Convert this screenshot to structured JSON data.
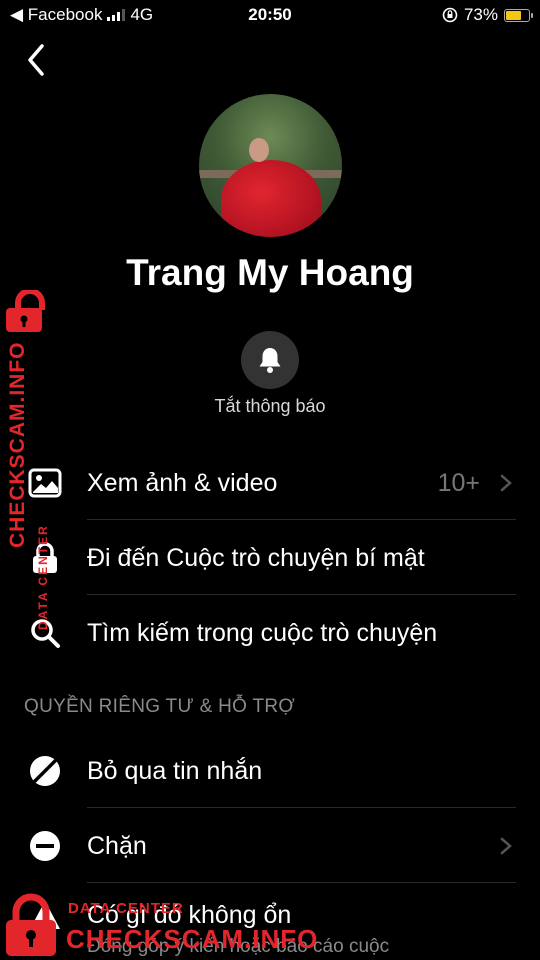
{
  "status_bar": {
    "back_app": "◀ Facebook",
    "network": "4G",
    "time": "20:50",
    "battery": "73%",
    "battery_level": 0.73,
    "battery_color": "#f5c518"
  },
  "header": {
    "back_icon": "chevron-left-icon"
  },
  "profile": {
    "name": "Trang My Hoang",
    "mute_label": "Tắt thông báo",
    "mute_icon": "bell-icon"
  },
  "menu": {
    "items": [
      {
        "label": "Xem ảnh & video",
        "count": "10+",
        "icon": "image-icon"
      },
      {
        "label": "Đi đến Cuộc trò chuyện bí mật",
        "icon": "lock-icon"
      },
      {
        "label": "Tìm kiếm trong cuộc trò chuyện",
        "icon": "search-icon"
      }
    ]
  },
  "privacy": {
    "section_title": "QUYỀN RIÊNG TƯ & HỖ TRỢ",
    "items": [
      {
        "label": "Bỏ qua tin nhắn",
        "icon": "ignore-icon"
      },
      {
        "label": "Chặn",
        "icon": "block-icon"
      },
      {
        "label": "Có gì đó không ổn",
        "subtitle": "Đóng góp ý kiến hoặc báo cáo cuộc",
        "icon": "warning-icon"
      }
    ]
  },
  "watermark": {
    "side_text": "CHECKSCAM.INFO",
    "side_small": "DATA CENTER",
    "bottom_small": "DATA CENTER",
    "bottom_text": "CHECKSCAM.INFO",
    "color": "#e3262b"
  }
}
